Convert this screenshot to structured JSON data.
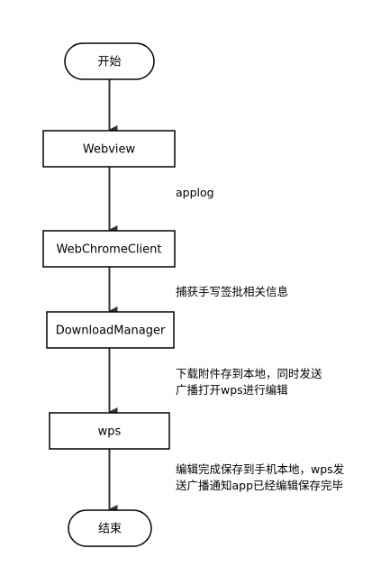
{
  "diagram": {
    "nodes": [
      {
        "id": "start",
        "label": "开始",
        "shape": "terminator"
      },
      {
        "id": "webview",
        "label": "Webview",
        "shape": "process"
      },
      {
        "id": "webchromeclient",
        "label": "WebChromeClient",
        "shape": "process"
      },
      {
        "id": "downloadmanager",
        "label": "DownloadManager",
        "shape": "process"
      },
      {
        "id": "wps",
        "label": "wps",
        "shape": "process"
      },
      {
        "id": "end",
        "label": "结束",
        "shape": "terminator"
      }
    ],
    "edges": [
      {
        "from": "start",
        "to": "webview",
        "label_lines": []
      },
      {
        "from": "webview",
        "to": "webchromeclient",
        "label_lines": [
          "applog"
        ]
      },
      {
        "from": "webchromeclient",
        "to": "downloadmanager",
        "label_lines": [
          "捕获手写签批相关信息"
        ]
      },
      {
        "from": "downloadmanager",
        "to": "wps",
        "label_lines": [
          "下载附件存到本地，同时发送",
          "广播打开wps进行编辑"
        ]
      },
      {
        "from": "wps",
        "to": "end",
        "label_lines": [
          "编辑完成保存到手机本地，wps发",
          "送广播通知app已经编辑保存完毕"
        ]
      }
    ],
    "colors": {
      "stroke": "#000000",
      "fill": "#ffffff",
      "arrow": "#333333",
      "text": "#000000"
    }
  }
}
